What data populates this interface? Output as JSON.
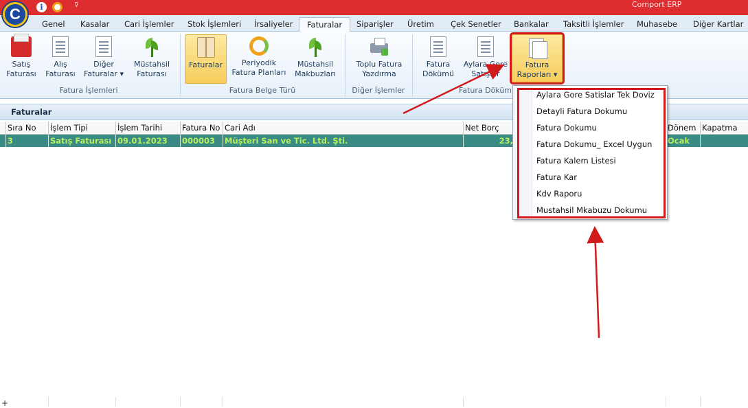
{
  "app": {
    "title": "Comport ERP",
    "logo_letter": "C",
    "info_glyph": "i",
    "pin_glyph": "⊽"
  },
  "tabs": [
    {
      "label": "Genel"
    },
    {
      "label": "Kasalar"
    },
    {
      "label": "Cari İşlemler"
    },
    {
      "label": "Stok İşlemleri"
    },
    {
      "label": "İrsaliyeler"
    },
    {
      "label": "Faturalar",
      "active": true
    },
    {
      "label": "Siparişler"
    },
    {
      "label": "Üretim"
    },
    {
      "label": "Çek Senetler"
    },
    {
      "label": "Bankalar"
    },
    {
      "label": "Taksitli İşlemler"
    },
    {
      "label": "Muhasebe"
    },
    {
      "label": "Diğer Kartlar"
    }
  ],
  "ribbon": {
    "buttons": {
      "satis": {
        "line1": "Satış",
        "line2": "Faturası",
        "icon": "red-folder-icon"
      },
      "alis": {
        "line1": "Alış",
        "line2": "Faturası",
        "icon": "document-icon"
      },
      "diger": {
        "line1": "Diğer",
        "line2": "Faturalar ▾",
        "icon": "document-edit-icon"
      },
      "mustahsil": {
        "line1": "Müstahsil",
        "line2": "Faturası",
        "icon": "plant-icon"
      },
      "faturalar": {
        "line1": "Faturalar",
        "icon": "book-icon"
      },
      "periyodik": {
        "line1": "Periyodik",
        "line2": "Fatura Planları",
        "icon": "refresh-icon"
      },
      "makbuz": {
        "line1": "Müstahsil",
        "line2": "Makbuzları",
        "icon": "plant-icon"
      },
      "toplu": {
        "line1": "Toplu Fatura",
        "line2": "Yazdırma",
        "icon": "printer-icon"
      },
      "dokumu": {
        "line1": "Fatura",
        "line2": "Dökümü",
        "icon": "document-icon"
      },
      "aylara": {
        "line1": "Aylara Gore",
        "line2": "Satışlar",
        "icon": "document-icon"
      },
      "raporlari": {
        "line1": "Fatura",
        "line2": "Raporları ▾",
        "icon": "documents-icon"
      }
    },
    "groups": {
      "fatura_islemleri": "Fatura İşlemleri",
      "fatura_belge_turu": "Fatura Belge Türü",
      "diger_islemler": "Diğer İşlemler",
      "fatura_dokumu": "Fatura Dökümü"
    }
  },
  "section": {
    "title": "Faturalar"
  },
  "grid": {
    "columns": [
      "Sıra No",
      "İşlem Tipi",
      "İşlem Tarihi",
      "Fatura No",
      "Cari Adı",
      "Net Borç",
      "Dönem",
      "Kapatma"
    ],
    "rows": [
      {
        "sira_no": "3",
        "islem_tipi": "Satış Faturası",
        "tarih": "09.01.2023",
        "fatura_no": "000003",
        "cari_adi": "Müşteri San ve Tic. Ltd. Şti.",
        "net_borc": "23,",
        "donem": "Ocak",
        "kapatma": ""
      }
    ]
  },
  "dropdown_menu": {
    "items": [
      "Aylara Gore Satislar Tek Doviz",
      "Detayli Fatura Dokumu",
      "Fatura Dokumu",
      "Fatura Dokumu_ Excel Uygun",
      "Fatura Kalem Listesi",
      "Fatura Kar",
      "Kdv Raporu",
      "Mustahsil Mkabuzu Dokumu"
    ]
  },
  "colors": {
    "titlebar": "#dd2d2e",
    "selected_row": "#3a8a86",
    "selected_row_text": "#b7f05b",
    "annotation": "#d11a1a"
  }
}
